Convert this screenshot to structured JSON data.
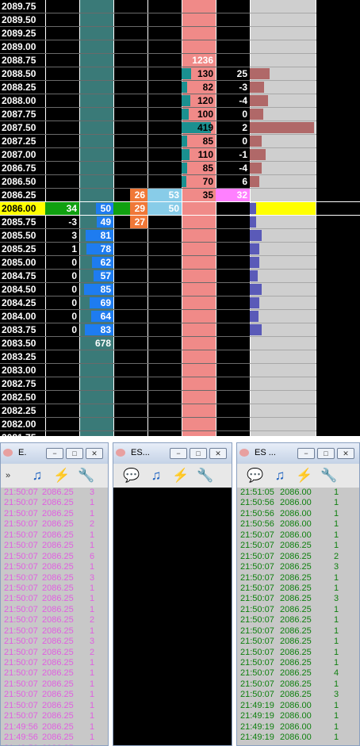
{
  "ladder": {
    "prices": [
      "2089.75",
      "2089.50",
      "2089.25",
      "2089.00",
      "2088.75",
      "2088.50",
      "2088.25",
      "2088.00",
      "2087.75",
      "2087.50",
      "2087.25",
      "2087.00",
      "2086.75",
      "2086.50",
      "2086.25",
      "2086.00",
      "2085.75",
      "2085.50",
      "2085.25",
      "2085.00",
      "2084.75",
      "2084.50",
      "2084.25",
      "2084.00",
      "2083.75",
      "2083.50",
      "2083.25",
      "2083.00",
      "2082.75",
      "2082.50",
      "2082.25",
      "2082.00",
      "2081.75"
    ],
    "current_price": "2086.00",
    "bid_delta": {
      "2086.00": "34",
      "2085.75": "-3",
      "2085.50": "3",
      "2085.25": "1",
      "2085.00": "0",
      "2084.75": "0",
      "2084.50": "0",
      "2084.25": "0",
      "2084.00": "0",
      "2083.75": "0"
    },
    "bid_size": {
      "2086.00": "50",
      "2085.75": "49",
      "2085.50": "81",
      "2085.25": "78",
      "2085.00": "62",
      "2084.75": "57",
      "2084.50": "85",
      "2084.25": "69",
      "2084.00": "64",
      "2083.75": "83",
      "2083.50": "678"
    },
    "bid_size_fill": {
      "2086.00": 0.5,
      "2085.75": 0.49,
      "2085.50": 0.81,
      "2085.25": 0.78,
      "2085.00": 0.62,
      "2084.75": 0.57,
      "2084.50": 0.85,
      "2084.25": 0.69,
      "2084.00": 0.64,
      "2083.75": 0.83
    },
    "sell_volume": {
      "2086.25": "26",
      "2086.00": "29",
      "2085.75": "27"
    },
    "buy_volume": {
      "2086.25": "53",
      "2086.00": "50"
    },
    "ask_size": {
      "2088.75": "1236",
      "2088.50": "130",
      "2088.25": "82",
      "2088.00": "120",
      "2087.75": "100",
      "2087.50": "419",
      "2087.25": "85",
      "2087.00": "110",
      "2086.75": "85",
      "2086.50": "70",
      "2086.25": "35"
    },
    "ask_size_fill": {
      "2088.50": 0.27,
      "2088.25": 0.17,
      "2088.00": 0.25,
      "2087.75": 0.21,
      "2087.50": 0.85,
      "2087.25": 0.17,
      "2087.00": 0.23,
      "2086.75": 0.17,
      "2086.50": 0.14
    },
    "ask_delta": {
      "2088.50": "25",
      "2088.25": "-3",
      "2088.00": "-4",
      "2087.75": "0",
      "2087.50": "2",
      "2087.25": "0",
      "2087.00": "-1",
      "2086.75": "-4",
      "2086.50": "6",
      "2086.25": "32"
    },
    "volume_profile_fill": {
      "2088.50": 0.3,
      "2088.25": 0.22,
      "2088.00": 0.28,
      "2087.75": 0.2,
      "2087.50": 0.98,
      "2087.25": 0.18,
      "2087.00": 0.24,
      "2086.75": 0.18,
      "2086.50": 0.14,
      "2086.00": 0.1,
      "2085.75": 0.1,
      "2085.50": 0.18,
      "2085.25": 0.15,
      "2085.00": 0.14,
      "2084.75": 0.12,
      "2084.50": 0.18,
      "2084.25": 0.15,
      "2084.00": 0.13,
      "2083.75": 0.18
    },
    "colors": {
      "bg": "#000000",
      "teal": "#3a7a78",
      "salmon": "#f08a88",
      "bid_bar": "#1e7cf0",
      "ask_bar_teal": "#1a9090",
      "sell_vol": "#f07838",
      "buy_vol": "#88cce8",
      "ask_delta_hl": "#ff80ff",
      "profile_up": "#b06868",
      "profile_down": "#5a5ab8",
      "current": "#ffff00",
      "green": "#10a010"
    }
  },
  "panes": [
    {
      "title": "E.",
      "buttons": [
        "−",
        "□",
        "✕"
      ],
      "toolbar": [
        "overflow-chevron",
        "music-note-icon",
        "battery-icon",
        "wrench-icon"
      ],
      "overflow_label": "»",
      "rows": [
        [
          "21:50:07",
          "2086.25",
          "3"
        ],
        [
          "21:50:07",
          "2086.25",
          "1"
        ],
        [
          "21:50:07",
          "2086.25",
          "1"
        ],
        [
          "21:50:07",
          "2086.25",
          "2"
        ],
        [
          "21:50:07",
          "2086.25",
          "1"
        ],
        [
          "21:50:07",
          "2086.25",
          "1"
        ],
        [
          "21:50:07",
          "2086.25",
          "6"
        ],
        [
          "21:50:07",
          "2086.25",
          "1"
        ],
        [
          "21:50:07",
          "2086.25",
          "3"
        ],
        [
          "21:50:07",
          "2086.25",
          "1"
        ],
        [
          "21:50:07",
          "2086.25",
          "1"
        ],
        [
          "21:50:07",
          "2086.25",
          "1"
        ],
        [
          "21:50:07",
          "2086.25",
          "2"
        ],
        [
          "21:50:07",
          "2086.25",
          "1"
        ],
        [
          "21:50:07",
          "2086.25",
          "3"
        ],
        [
          "21:50:07",
          "2086.25",
          "2"
        ],
        [
          "21:50:07",
          "2086.25",
          "1"
        ],
        [
          "21:50:07",
          "2086.25",
          "1"
        ],
        [
          "21:50:07",
          "2086.25",
          "1"
        ],
        [
          "21:50:07",
          "2086.25",
          "1"
        ],
        [
          "21:50:07",
          "2086.25",
          "1"
        ],
        [
          "21:50:07",
          "2086.25",
          "1"
        ],
        [
          "21:49:56",
          "2086.25",
          "1"
        ],
        [
          "21:49:56",
          "2086.25",
          "1"
        ],
        [
          "21:49:56",
          "2086.25",
          "1"
        ],
        [
          "21:49:56",
          "2086.25",
          "1"
        ]
      ],
      "text_color": "#e060e0"
    },
    {
      "title": "ES...",
      "buttons": [
        "−",
        "□",
        "✕"
      ],
      "toolbar": [
        "speech-bubble-icon",
        "music-note-icon",
        "battery-icon",
        "wrench-icon"
      ],
      "rows": []
    },
    {
      "title": "ES ...",
      "buttons": [
        "−",
        "□",
        "✕"
      ],
      "toolbar": [
        "speech-bubble-icon",
        "music-note-icon",
        "battery-icon",
        "wrench-icon"
      ],
      "rows": [
        [
          "21:51:05",
          "2086.00",
          "1"
        ],
        [
          "21:50:56",
          "2086.00",
          "1"
        ],
        [
          "21:50:56",
          "2086.00",
          "1"
        ],
        [
          "21:50:56",
          "2086.00",
          "1"
        ],
        [
          "21:50:07",
          "2086.00",
          "1"
        ],
        [
          "21:50:07",
          "2086.25",
          "1"
        ],
        [
          "21:50:07",
          "2086.25",
          "2"
        ],
        [
          "21:50:07",
          "2086.25",
          "3"
        ],
        [
          "21:50:07",
          "2086.25",
          "1"
        ],
        [
          "21:50:07",
          "2086.25",
          "1"
        ],
        [
          "21:50:07",
          "2086.25",
          "3"
        ],
        [
          "21:50:07",
          "2086.25",
          "1"
        ],
        [
          "21:50:07",
          "2086.25",
          "1"
        ],
        [
          "21:50:07",
          "2086.25",
          "1"
        ],
        [
          "21:50:07",
          "2086.25",
          "1"
        ],
        [
          "21:50:07",
          "2086.25",
          "1"
        ],
        [
          "21:50:07",
          "2086.25",
          "1"
        ],
        [
          "21:50:07",
          "2086.25",
          "4"
        ],
        [
          "21:50:07",
          "2086.25",
          "1"
        ],
        [
          "21:50:07",
          "2086.25",
          "3"
        ],
        [
          "21:49:19",
          "2086.00",
          "1"
        ],
        [
          "21:49:19",
          "2086.00",
          "1"
        ],
        [
          "21:49:19",
          "2086.00",
          "1"
        ],
        [
          "21:49:19",
          "2086.00",
          "1"
        ]
      ],
      "text_color": "#108010"
    }
  ]
}
